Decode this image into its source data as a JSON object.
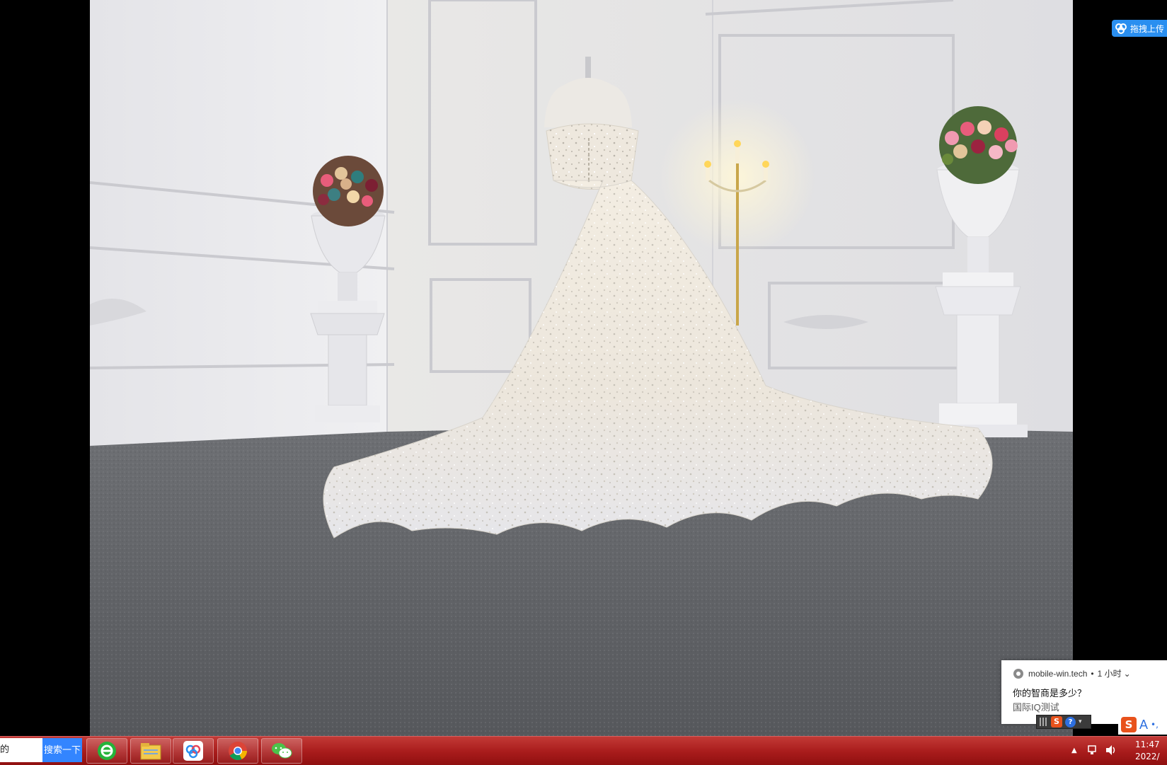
{
  "cloud_widget": {
    "label": "拖拽上传",
    "icon": "cloud-icon",
    "color": "#2a8ff0"
  },
  "notification": {
    "source": "mobile-win.tech",
    "time": "1 小时",
    "title": "你的智商是多少？",
    "subtitle": "国际IQ测试"
  },
  "taskbar": {
    "search_text": "的",
    "search_button": "搜索一下",
    "apps": [
      {
        "name": "ie-browser",
        "icon": "browser-e-icon"
      },
      {
        "name": "file-explorer",
        "icon": "folder-icon"
      },
      {
        "name": "cloud-drive",
        "icon": "cloud-icon"
      },
      {
        "name": "chrome",
        "icon": "chrome-icon"
      },
      {
        "name": "wechat",
        "icon": "wechat-icon"
      }
    ],
    "clock_time": "11:47",
    "clock_date": "2022/",
    "color": "#a81b1b"
  },
  "ime": {
    "logo": "S",
    "mode": "A"
  }
}
